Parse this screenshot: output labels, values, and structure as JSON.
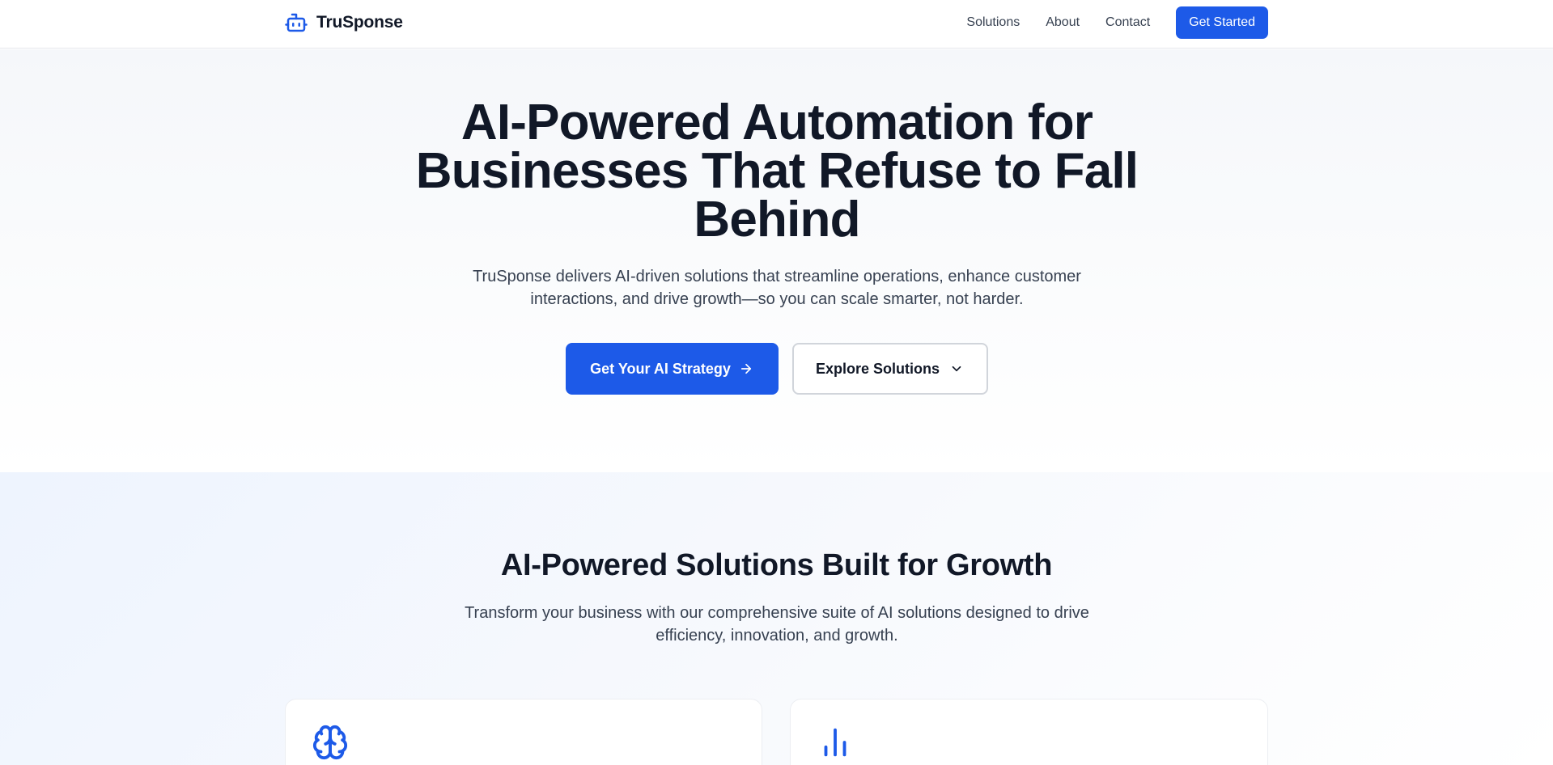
{
  "nav": {
    "brand": "TruSponse",
    "links": [
      "Solutions",
      "About",
      "Contact"
    ],
    "cta": "Get Started"
  },
  "hero": {
    "title_lines": [
      "AI-Powered Automation for",
      "Businesses That Refuse to Fall",
      "Behind"
    ],
    "subtitle": "TruSponse delivers AI-driven solutions that streamline operations, enhance customer interactions, and drive growth—so you can scale smarter, not harder.",
    "primary_button": "Get Your AI Strategy",
    "secondary_button": "Explore Solutions"
  },
  "solutions": {
    "title": "AI-Powered Solutions Built for Growth",
    "subtitle": "Transform your business with our comprehensive suite of AI solutions designed to drive efficiency, innovation, and growth.",
    "cards": [
      {
        "icon": "brain-icon"
      },
      {
        "icon": "bar-chart-icon"
      }
    ]
  },
  "colors": {
    "accent": "#1d5ae8",
    "text": "#111827",
    "muted_text": "#374151"
  }
}
